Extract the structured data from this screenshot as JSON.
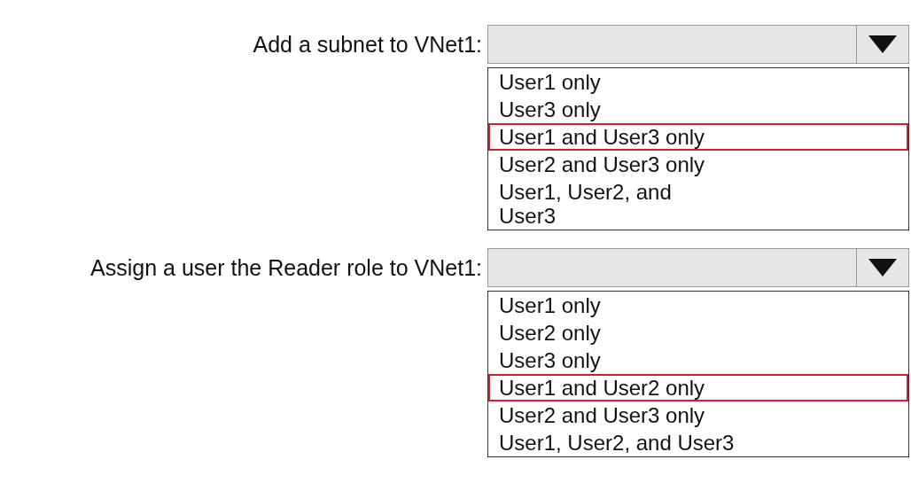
{
  "questions": [
    {
      "label": "Add a subnet to VNet1:",
      "options": [
        {
          "text": "User1 only",
          "selected": false
        },
        {
          "text": "User3 only",
          "selected": false
        },
        {
          "text": "User1 and User3 only",
          "selected": true
        },
        {
          "text": "User2 and User3 only",
          "selected": false
        },
        {
          "text": "User1, User2, and\nUser3",
          "selected": false
        }
      ]
    },
    {
      "label": "Assign a user the Reader role to VNet1:",
      "options": [
        {
          "text": "User1 only",
          "selected": false
        },
        {
          "text": "User2 only",
          "selected": false
        },
        {
          "text": "User3 only",
          "selected": false
        },
        {
          "text": "User1 and User2 only",
          "selected": true
        },
        {
          "text": "User2 and User3 only",
          "selected": false
        },
        {
          "text": "User1, User2, and User3",
          "selected": false
        }
      ]
    }
  ]
}
